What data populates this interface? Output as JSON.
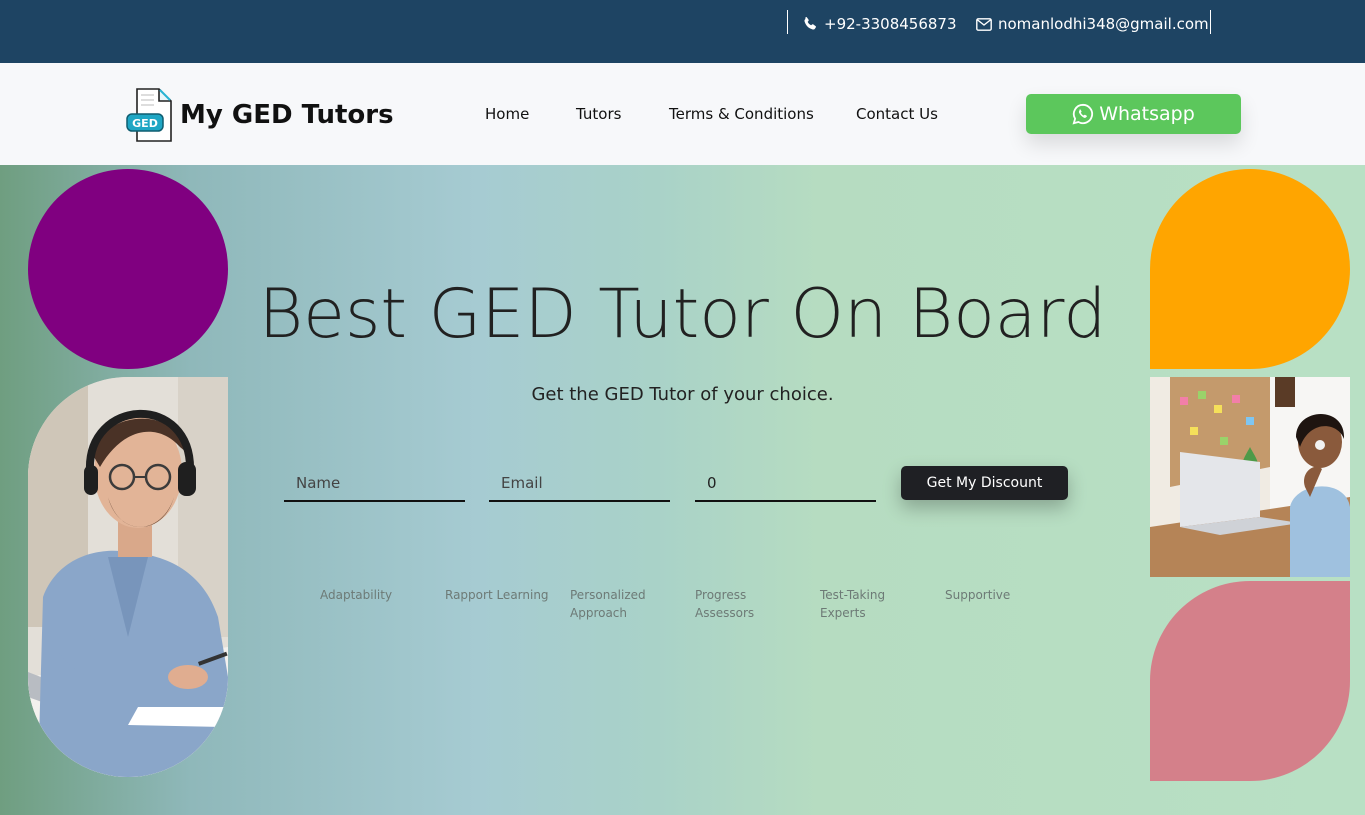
{
  "topbar": {
    "phone": "+92-3308456873",
    "email": "nomanlodhi348@gmail.com",
    "icons": [
      "phone-icon",
      "envelope-icon"
    ]
  },
  "brand": {
    "badge": "GED",
    "name": "My GED Tutors"
  },
  "nav": {
    "items": [
      {
        "label": "Home"
      },
      {
        "label": "Tutors"
      },
      {
        "label": "Terms & Conditions"
      },
      {
        "label": "Contact Us"
      }
    ],
    "whatsapp_label": "Whatsapp"
  },
  "hero": {
    "title": "Best GED Tutor On Board",
    "subtitle": "Get the GED Tutor of your choice.",
    "form": {
      "name_placeholder": "Name",
      "email_placeholder": "Email",
      "number_value": "0",
      "submit_label": "Get My Discount"
    },
    "features": [
      "Adaptability",
      "Rapport Learning",
      "Personalized Approach",
      "Progress Assessors",
      "Test-Taking Experts",
      "Supportive"
    ]
  },
  "colors": {
    "topbar": "#1e4463",
    "whatsapp": "#5cc75c",
    "purple": "#800080",
    "orange": "#ffa500",
    "pink": "#d4808a",
    "button_dark": "#1f2024"
  }
}
